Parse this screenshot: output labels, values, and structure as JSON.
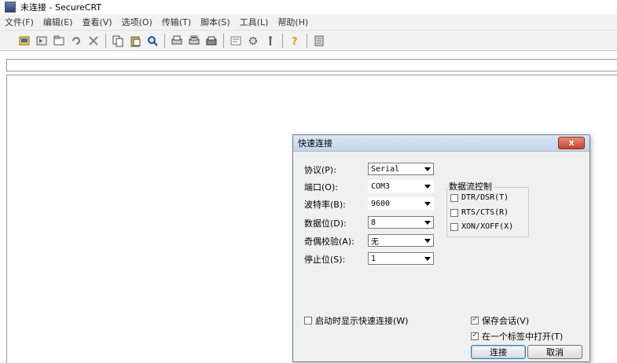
{
  "window": {
    "title": "未连接 - SecureCRT"
  },
  "menubar": {
    "items": [
      "文件(F)",
      "编辑(E)",
      "查看(V)",
      "选项(O)",
      "传输(T)",
      "脚本(S)",
      "工具(L)",
      "帮助(H)"
    ]
  },
  "toolbar": {
    "icons": [
      "connect-icon",
      "quick-connect-icon",
      "connect-tab-icon",
      "reconnect-icon",
      "disconnect-icon",
      "copy-icon",
      "paste-icon",
      "find-icon",
      "print-icon",
      "print-selection-icon",
      "printer-setup-icon",
      "session-options-icon",
      "global-options-icon",
      "keymap-icon",
      "help-icon",
      "sftp-icon"
    ]
  },
  "dialog": {
    "title": "快速连接",
    "close_label": "x",
    "protocol": {
      "label": "协议(P):",
      "value": "Serial"
    },
    "port": {
      "label": "端口(O):",
      "value": "COM3"
    },
    "baud": {
      "label": "波特率(B):",
      "value": "9600"
    },
    "databits": {
      "label": "数据位(D):",
      "value": "8"
    },
    "parity": {
      "label": "奇偶校验(A):",
      "value": "无"
    },
    "stopbits": {
      "label": "停止位(S):",
      "value": "1"
    },
    "flow_control": {
      "title": "数据流控制",
      "options": [
        {
          "label": "DTR/DSR(T)",
          "checked": false
        },
        {
          "label": "RTS/CTS(R)",
          "checked": false
        },
        {
          "label": "XON/XOFF(X)",
          "checked": false
        }
      ]
    },
    "show_on_startup": {
      "label": "启动时显示快速连接(W)",
      "checked": false
    },
    "save_session": {
      "label": "保存会话(V)",
      "checked": true
    },
    "open_in_tab": {
      "label": "在一个标签中打开(T)",
      "checked": true
    },
    "connect_button": "连接",
    "cancel_button": "取消"
  }
}
